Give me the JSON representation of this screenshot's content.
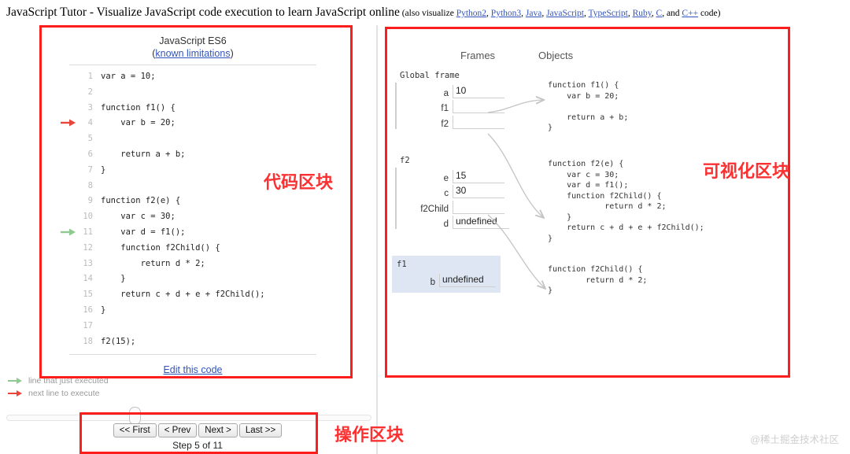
{
  "header": {
    "title": "JavaScript Tutor - Visualize JavaScript code execution to learn JavaScript online",
    "also_prefix": "(also visualize ",
    "links": [
      "Python2",
      "Python3",
      "Java",
      "JavaScript",
      "TypeScript",
      "Ruby",
      "C",
      "C++"
    ],
    "also_suffix": " code)",
    "and_word": "and"
  },
  "code_panel": {
    "lang_title": "JavaScript ES6",
    "limitations_open": "(",
    "limitations_link": "known limitations",
    "limitations_close": ")",
    "edit_link": "Edit this code",
    "lines": [
      {
        "n": "1",
        "text": "var a = 10;",
        "marker": "none"
      },
      {
        "n": "2",
        "text": "",
        "marker": "none"
      },
      {
        "n": "3",
        "text": "function f1() {",
        "marker": "none"
      },
      {
        "n": "4",
        "text": "    var b = 20;",
        "marker": "red"
      },
      {
        "n": "5",
        "text": "",
        "marker": "none"
      },
      {
        "n": "6",
        "text": "    return a + b;",
        "marker": "none"
      },
      {
        "n": "7",
        "text": "}",
        "marker": "none"
      },
      {
        "n": "8",
        "text": "",
        "marker": "none"
      },
      {
        "n": "9",
        "text": "function f2(e) {",
        "marker": "none"
      },
      {
        "n": "10",
        "text": "    var c = 30;",
        "marker": "none"
      },
      {
        "n": "11",
        "text": "    var d = f1();",
        "marker": "green"
      },
      {
        "n": "12",
        "text": "    function f2Child() {",
        "marker": "none"
      },
      {
        "n": "13",
        "text": "        return d * 2;",
        "marker": "none"
      },
      {
        "n": "14",
        "text": "    }",
        "marker": "none"
      },
      {
        "n": "15",
        "text": "    return c + d + e + f2Child();",
        "marker": "none"
      },
      {
        "n": "16",
        "text": "}",
        "marker": "none"
      },
      {
        "n": "17",
        "text": "",
        "marker": "none"
      },
      {
        "n": "18",
        "text": "f2(15);",
        "marker": "none"
      }
    ]
  },
  "legend": {
    "just_executed": "line that just executed",
    "next_line": "next line to execute",
    "green_color": "#8fca8f",
    "red_color": "#e8453c"
  },
  "controls": {
    "first": "<< First",
    "prev": "< Prev",
    "next": "Next >",
    "last": "Last >>",
    "step_label": "Step 5 of 11",
    "current_step": 5,
    "total_steps": 11
  },
  "viz": {
    "frames_title": "Frames",
    "objects_title": "Objects",
    "frames": [
      {
        "name": "Global frame",
        "highlighted": false,
        "vars": [
          {
            "name": "a",
            "value": "10",
            "pointer": false
          },
          {
            "name": "f1",
            "value": "",
            "pointer": true
          },
          {
            "name": "f2",
            "value": "",
            "pointer": true
          }
        ]
      },
      {
        "name": "f2",
        "highlighted": false,
        "vars": [
          {
            "name": "e",
            "value": "15",
            "pointer": false
          },
          {
            "name": "c",
            "value": "30",
            "pointer": false
          },
          {
            "name": "f2Child",
            "value": "",
            "pointer": true
          },
          {
            "name": "d",
            "value": "undefined",
            "pointer": false
          }
        ]
      },
      {
        "name": "f1",
        "highlighted": true,
        "vars": [
          {
            "name": "b",
            "value": "undefined",
            "pointer": false
          }
        ]
      }
    ],
    "objects": [
      "function f1() {\n    var b = 20;\n\n    return a + b;\n}",
      "function f2(e) {\n    var c = 30;\n    var d = f1();\n    function f2Child() {\n            return d * 2;\n    }\n    return c + d + e + f2Child();\n}",
      "function f2Child() {\n        return d * 2;\n}"
    ]
  },
  "annotations": {
    "code_region_label": "代码区块",
    "viz_region_label": "可视化区块",
    "controls_region_label": "操作区块",
    "box_color": "#fc1d1d"
  },
  "watermark": "@稀土掘金技术社区"
}
